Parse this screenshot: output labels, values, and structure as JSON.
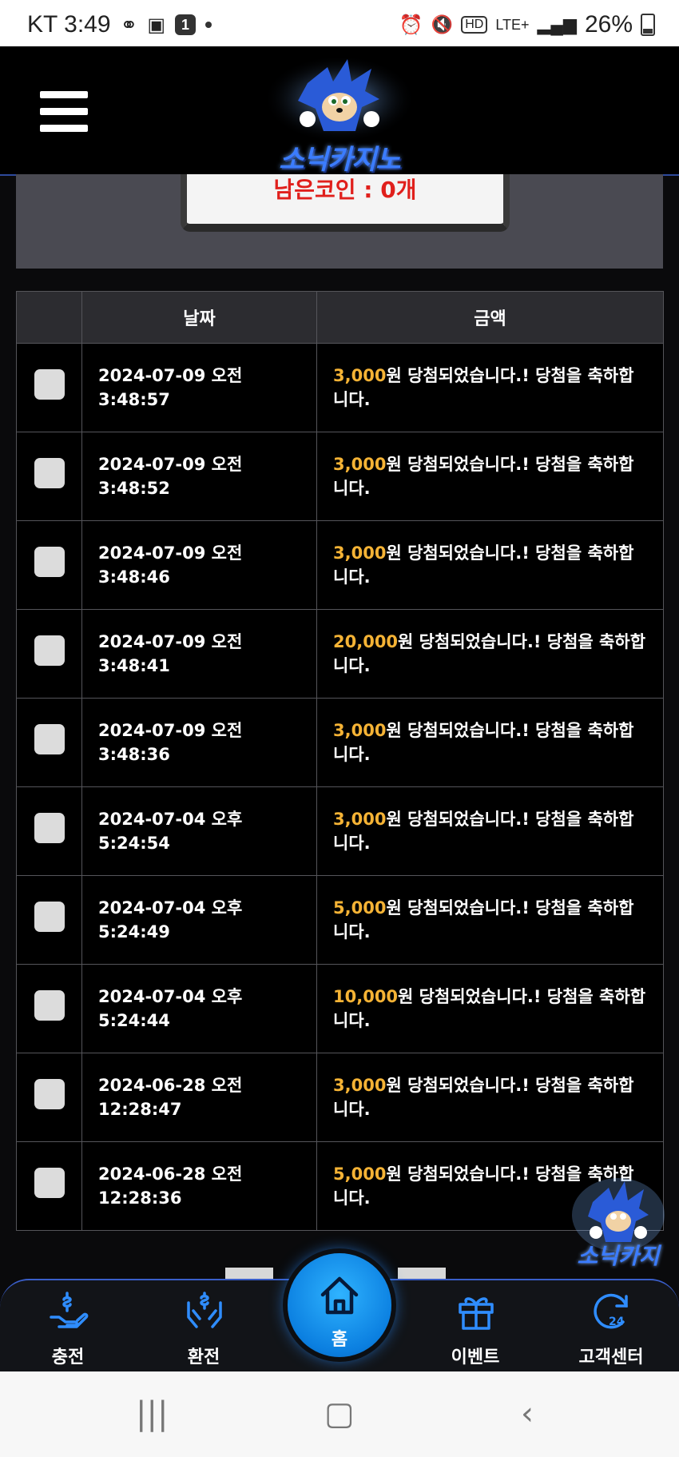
{
  "statusbar": {
    "carrier_time": "KT 3:49",
    "notification_count": "1",
    "network": "LTE+",
    "battery": "26%"
  },
  "header": {
    "logo_text": "소닉카지노",
    "menu_icon": "hamburger-menu-icon"
  },
  "coins": {
    "remaining_label": "남은코인 : 0개"
  },
  "table": {
    "headers": [
      "",
      "날짜",
      "금액"
    ],
    "rows": [
      {
        "date_line1": "2024-07-09 오전",
        "date_line2": "3:48:57",
        "amount": "3,000",
        "message": "원 당첨되었습니다.! 당첨을 축하합니다."
      },
      {
        "date_line1": "2024-07-09 오전",
        "date_line2": "3:48:52",
        "amount": "3,000",
        "message": "원 당첨되었습니다.! 당첨을 축하합니다."
      },
      {
        "date_line1": "2024-07-09 오전",
        "date_line2": "3:48:46",
        "amount": "3,000",
        "message": "원 당첨되었습니다.! 당첨을 축하합니다."
      },
      {
        "date_line1": "2024-07-09 오전",
        "date_line2": "3:48:41",
        "amount": "20,000",
        "message": "원 당첨되었습니다.! 당첨을 축하합니다."
      },
      {
        "date_line1": "2024-07-09 오전",
        "date_line2": "3:48:36",
        "amount": "3,000",
        "message": "원 당첨되었습니다.! 당첨을 축하합니다."
      },
      {
        "date_line1": "2024-07-04 오후",
        "date_line2": "5:24:54",
        "amount": "3,000",
        "message": "원 당첨되었습니다.! 당첨을 축하합니다."
      },
      {
        "date_line1": "2024-07-04 오후",
        "date_line2": "5:24:49",
        "amount": "5,000",
        "message": "원 당첨되었습니다.! 당첨을 축하합니다."
      },
      {
        "date_line1": "2024-07-04 오후",
        "date_line2": "5:24:44",
        "amount": "10,000",
        "message": "원 당첨되었습니다.! 당첨을 축하합니다."
      },
      {
        "date_line1": "2024-06-28 오전",
        "date_line2": "12:28:47",
        "amount": "3,000",
        "message": "원 당첨되었습니다.! 당첨을 축하합니다."
      },
      {
        "date_line1": "2024-06-28 오전",
        "date_line2": "12:28:36",
        "amount": "5,000",
        "message": "원 당첨되었습니다.! 당첨을 축하합니다."
      }
    ]
  },
  "floating_logo_text": "소닉카지",
  "bottom_nav": {
    "deposit": "충전",
    "withdraw": "환전",
    "home": "홈",
    "event": "이벤트",
    "support": "고객센터"
  },
  "colors": {
    "accent_blue": "#1f8fff",
    "amount_gold": "#f5b335",
    "coin_red": "#e0201c"
  }
}
